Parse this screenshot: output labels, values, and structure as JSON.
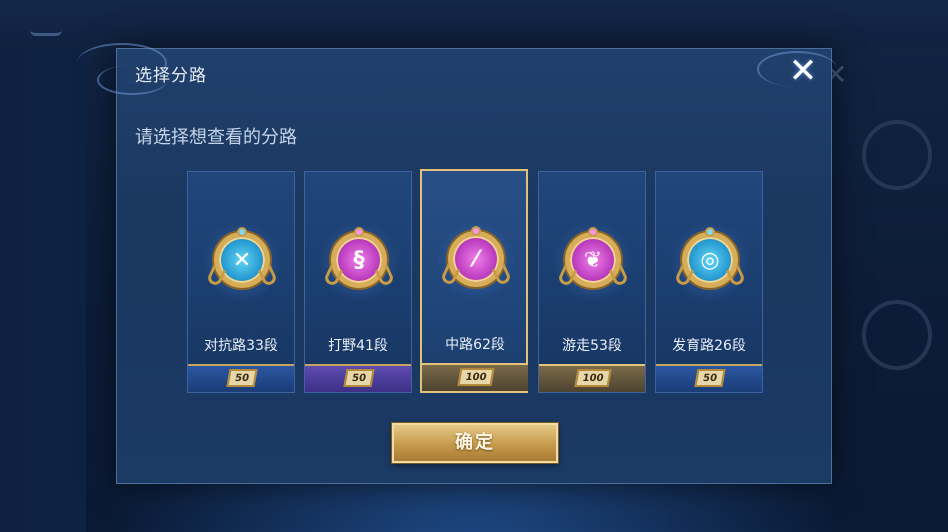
{
  "dialog": {
    "title": "选择分路",
    "close_icon": "close-icon",
    "subtitle": "请选择想查看的分路",
    "confirm_label": "确定",
    "roles": [
      {
        "label": "对抗路33段",
        "badge": "50",
        "icon": "sword-cross-icon",
        "emblem_color": "blue",
        "banner": "blue"
      },
      {
        "label": "打野41段",
        "badge": "50",
        "icon": "dragon-icon",
        "emblem_color": "pink",
        "banner": "purple"
      },
      {
        "label": "中路62段",
        "badge": "100",
        "icon": "staff-icon",
        "emblem_color": "pink",
        "banner": "gold",
        "selected": true
      },
      {
        "label": "游走53段",
        "badge": "100",
        "icon": "wings-icon",
        "emblem_color": "pink",
        "banner": "gold"
      },
      {
        "label": "发育路26段",
        "badge": "50",
        "icon": "target-icon",
        "emblem_color": "blue",
        "banner": "blue"
      }
    ]
  },
  "colors": {
    "modal_bg": "#1b3a64",
    "gold_accent": "#d7ad58",
    "selected_border": "#e2c27a"
  }
}
